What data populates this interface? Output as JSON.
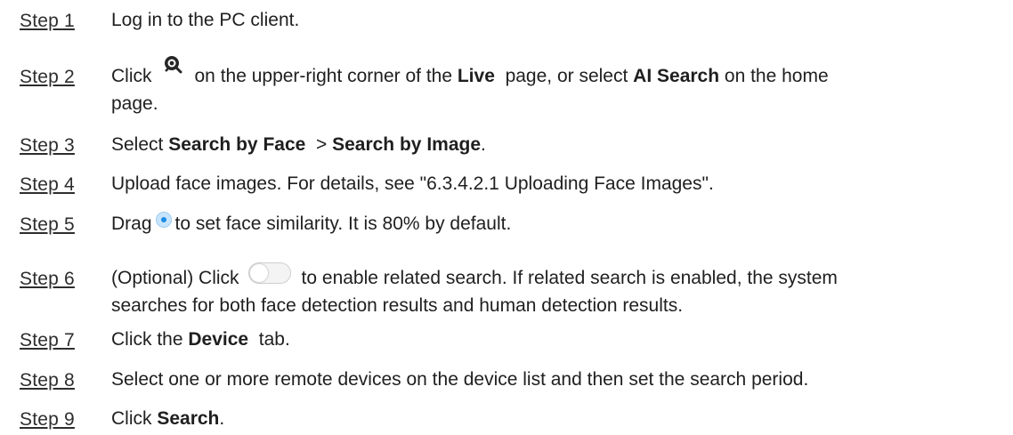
{
  "steps": [
    {
      "label": "Step 1",
      "parts": [
        "Log in to the PC client."
      ]
    },
    {
      "label": "Step 2",
      "parts": [
        "Click",
        "on the upper-right corner of the",
        "Live",
        "page, or select",
        "AI Search",
        "on the home",
        "page."
      ]
    },
    {
      "label": "Step 3",
      "parts": [
        "Select",
        "Search by Face",
        "> ",
        "Search by Image",
        "."
      ]
    },
    {
      "label": "Step 4",
      "parts": [
        "Upload face images. For details, see \"6.3.4.2.1 Uploading Face Images\"."
      ]
    },
    {
      "label": "Step 5",
      "parts": [
        "Drag",
        "to set face similarity. It is 80% by default."
      ]
    },
    {
      "label": "Step 6",
      "parts": [
        "(Optional) Click",
        "to enable related search. If related search is enabled, the system",
        "searches for both face detection results and human detection results."
      ]
    },
    {
      "label": "Step 7",
      "parts": [
        "Click the",
        "Device",
        "tab."
      ]
    },
    {
      "label": "Step 8",
      "parts": [
        "Select one or more remote devices on the device list and then set the search period."
      ]
    },
    {
      "label": "Step 9",
      "parts": [
        "Click",
        "Search",
        "."
      ]
    }
  ],
  "icons": {
    "step2": "ai-search-face-icon",
    "step5": "slider-handle-icon",
    "step6": "toggle-switch-icon"
  },
  "colors": {
    "text": "#1f1f1f",
    "slider_accent": "#1c8ce6",
    "toggle_border": "#cfcfcf"
  }
}
